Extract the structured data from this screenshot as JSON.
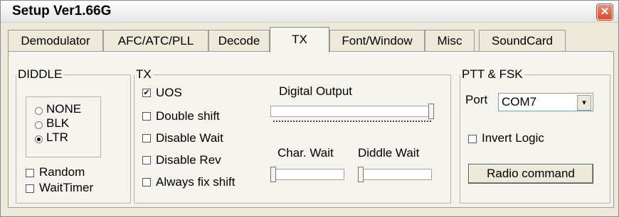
{
  "title": "Setup Ver1.66G",
  "close_icon": "✕",
  "tabs": [
    "Demodulator",
    "AFC/ATC/PLL",
    "Decode",
    "TX",
    "Font/Window",
    "Misc",
    "SoundCard"
  ],
  "active_tab": "TX",
  "diddle": {
    "label": "DIDDLE",
    "options": [
      "NONE",
      "BLK",
      "LTR"
    ],
    "selected": "LTR",
    "random_label": "Random",
    "random_checked": false,
    "waittimer_label": "WaitTimer",
    "waittimer_checked": false
  },
  "tx": {
    "label": "TX",
    "checkboxes": [
      {
        "label": "UOS",
        "checked": true
      },
      {
        "label": "Double shift",
        "checked": false
      },
      {
        "label": "Disable Wait",
        "checked": false
      },
      {
        "label": "Disable Rev",
        "checked": false
      },
      {
        "label": "Always fix shift",
        "checked": false
      }
    ],
    "digital_output_label": "Digital Output",
    "digital_output_level": 1.0,
    "char_wait_label": "Char. Wait",
    "char_wait_level": 0.0,
    "diddle_wait_label": "Diddle Wait",
    "diddle_wait_level": 0.0
  },
  "ptt": {
    "label": "PTT & FSK",
    "port_label": "Port",
    "port_value": "COM7",
    "invert_label": "Invert Logic",
    "invert_checked": false,
    "radio_button_label": "Radio command"
  }
}
